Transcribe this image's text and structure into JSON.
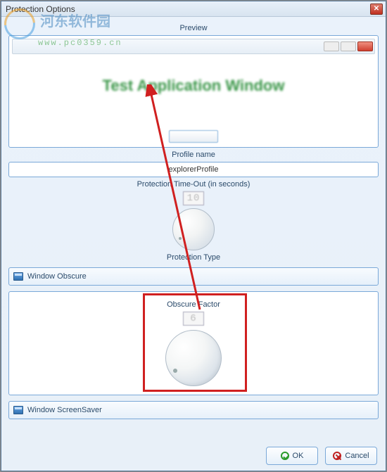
{
  "window": {
    "title": "Protection Options"
  },
  "sections": {
    "preview_label": "Preview",
    "profile_label": "Profile name",
    "timeout_label": "Protection Time-Out (in seconds)",
    "type_label": "Protection Type"
  },
  "preview": {
    "app_title": "Test Application Window"
  },
  "profile": {
    "value": "explorerProfile"
  },
  "timeout": {
    "display": "10"
  },
  "groups": {
    "obscure_label": "Window Obscure",
    "screensaver_label": "Window ScreenSaver"
  },
  "obscure": {
    "factor_label": "Obscure Factor",
    "factor_display": "6"
  },
  "buttons": {
    "ok": "OK",
    "cancel": "Cancel"
  },
  "watermark": {
    "cn": "河东软件园",
    "url": "www.pc0359.cn"
  }
}
